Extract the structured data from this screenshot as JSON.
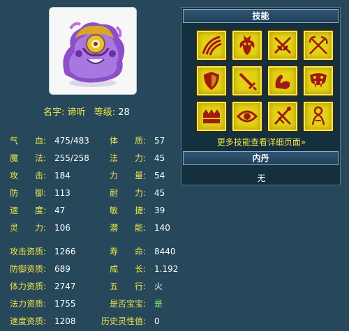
{
  "pet": {
    "name_label": "名字:",
    "name": "谛听",
    "level_label": "等级:",
    "level": "28"
  },
  "stats_left": [
    {
      "label": "气　　血:",
      "value": "475/483"
    },
    {
      "label": "魔　　法:",
      "value": "255/258"
    },
    {
      "label": "攻　　击:",
      "value": "184"
    },
    {
      "label": "防　　御:",
      "value": "113"
    },
    {
      "label": "速　　度:",
      "value": "47"
    },
    {
      "label": "灵　　力:",
      "value": "106"
    }
  ],
  "stats_right": [
    {
      "label": "体　　质:",
      "value": "57"
    },
    {
      "label": "法　　力:",
      "value": "45"
    },
    {
      "label": "力　　量:",
      "value": "54"
    },
    {
      "label": "耐　　力:",
      "value": "45"
    },
    {
      "label": "敏　　捷:",
      "value": "39"
    },
    {
      "label": "潜　　能:",
      "value": "140"
    }
  ],
  "aptitudes_left": [
    {
      "label": "攻击资质:",
      "value": "1266"
    },
    {
      "label": "防御资质:",
      "value": "689"
    },
    {
      "label": "体力资质:",
      "value": "2747"
    },
    {
      "label": "法力资质:",
      "value": "1755"
    },
    {
      "label": "速度资质:",
      "value": "1208"
    }
  ],
  "aptitudes_right": [
    {
      "label": "寿　　命:",
      "value": "8440"
    },
    {
      "label": "成　　长:",
      "value": "1.192"
    },
    {
      "label": "五　　行:",
      "value": "火"
    },
    {
      "label": "是否宝宝:",
      "value": "是"
    },
    {
      "label": "历史灵性值:",
      "value": "0"
    }
  ],
  "skills_panel": {
    "title": "技能",
    "more_link": "更多技能查看详细页面»",
    "skills": [
      {
        "icon": "claw-slash-icon"
      },
      {
        "icon": "demon-wing-icon"
      },
      {
        "icon": "crossed-daggers-icon"
      },
      {
        "icon": "crossed-swords-icon"
      },
      {
        "icon": "shield-icon"
      },
      {
        "icon": "sword-icon"
      },
      {
        "icon": "flexed-arm-icon"
      },
      {
        "icon": "fanged-mask-icon"
      },
      {
        "icon": "crown-bar-icon"
      },
      {
        "icon": "eye-icon"
      },
      {
        "icon": "crossed-staffs-icon"
      },
      {
        "icon": "kneeling-figure-icon"
      }
    ]
  },
  "neidan_panel": {
    "title": "内丹",
    "value": "无"
  },
  "colors": {
    "background": "#26485a",
    "label": "#f0e34a",
    "value": "#ffffff",
    "highlight_green": "#7dff62",
    "skill_tile": "#e3d215",
    "skill_glyph": "#a11a12"
  }
}
